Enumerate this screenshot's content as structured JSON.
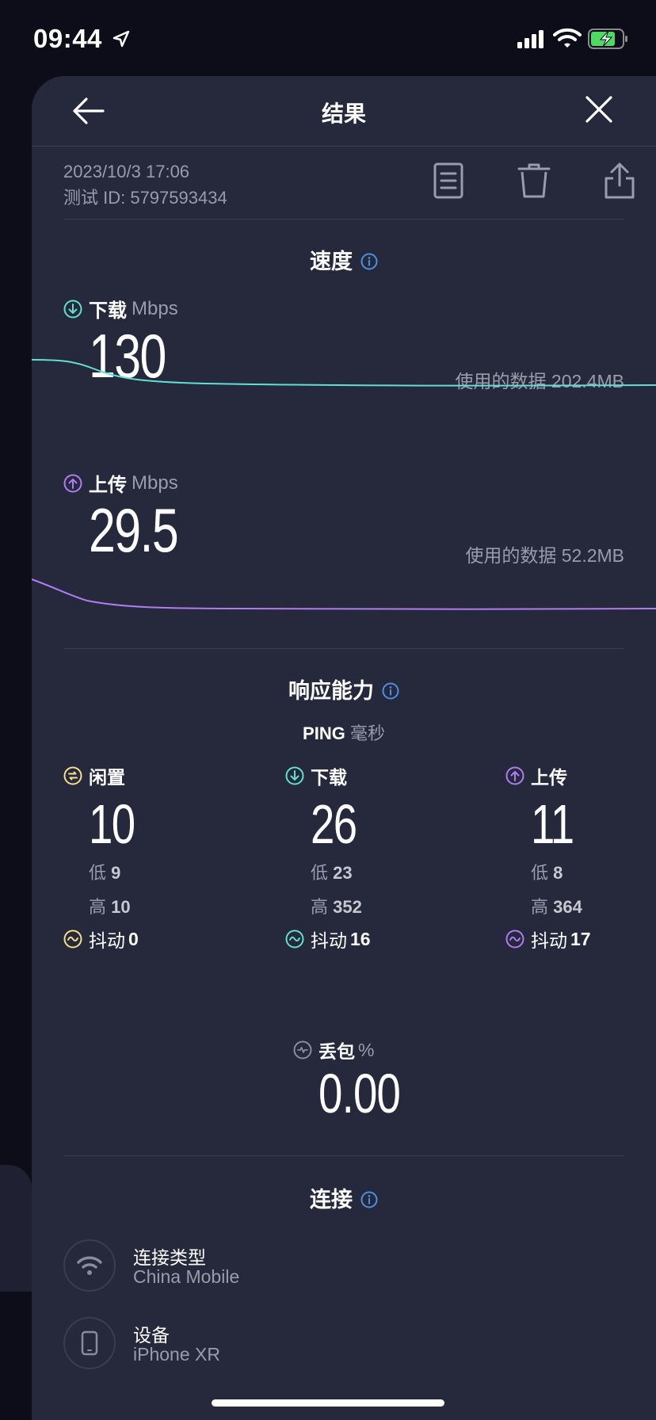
{
  "status_bar": {
    "time": "09:44"
  },
  "header": {
    "title": "结果"
  },
  "meta": {
    "date": "2023/10/3 17:06",
    "test_id": "测试 ID: 5797593434"
  },
  "speed": {
    "title": "速度",
    "download": {
      "label": "下载",
      "unit": "Mbps",
      "value": "130",
      "data_used": "使用的数据 202.4MB",
      "color": "#5fe0d0"
    },
    "upload": {
      "label": "上传",
      "unit": "Mbps",
      "value": "29.5",
      "data_used": "使用的数据 52.2MB",
      "color": "#b07cf2"
    }
  },
  "responsiveness": {
    "title": "响应能力",
    "ping_label": "PING",
    "ping_unit": "毫秒",
    "columns": [
      {
        "label": "闲置",
        "value": "10",
        "low_label": "低",
        "low": "9",
        "high_label": "高",
        "high": "10",
        "jitter_label": "抖动",
        "jitter": "0",
        "color": "#f2e08a"
      },
      {
        "label": "下载",
        "value": "26",
        "low_label": "低",
        "low": "23",
        "high_label": "高",
        "high": "352",
        "jitter_label": "抖动",
        "jitter": "16",
        "color": "#5fe0d0"
      },
      {
        "label": "上传",
        "value": "11",
        "low_label": "低",
        "low": "8",
        "high_label": "高",
        "high": "364",
        "jitter_label": "抖动",
        "jitter": "17",
        "color": "#b07cf2"
      }
    ],
    "packet_loss": {
      "label": "丢包",
      "unit": "%",
      "value": "0.00"
    }
  },
  "connection": {
    "title": "连接",
    "items": [
      {
        "label": "连接类型",
        "value": "China Mobile",
        "icon": "wifi-icon"
      },
      {
        "label": "设备",
        "value": "iPhone XR",
        "icon": "phone-icon"
      }
    ]
  },
  "colors": {
    "background": "#0d0d1a",
    "sheet": "#26283b",
    "accent_info": "#4a90e2"
  }
}
